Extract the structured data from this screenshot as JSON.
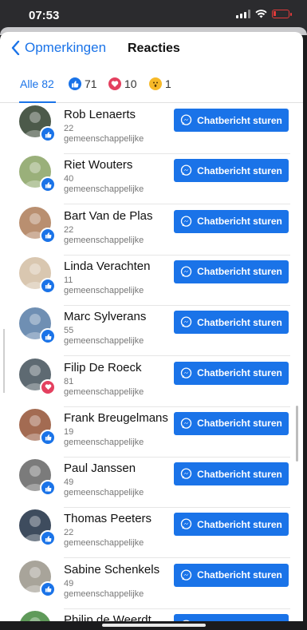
{
  "status": {
    "time": "07:53"
  },
  "nav": {
    "back_label": "Opmerkingen",
    "title": "Reacties"
  },
  "tabs": [
    {
      "label": "Alle 82"
    },
    {
      "label": "71",
      "icon": "like-icon",
      "color": "#1a73e8"
    },
    {
      "label": "10",
      "icon": "heart-icon",
      "color": "#e4405f"
    },
    {
      "label": "1",
      "icon": "wow-icon",
      "color": "#f7b928"
    }
  ],
  "chat_label": "Chatbericht sturen",
  "people": [
    {
      "name": "Rob Lenaerts",
      "count": "22",
      "sub": "gemeenschappelijke",
      "reaction": "like",
      "avatar_color": "#4c5a4a"
    },
    {
      "name": "Riet Wouters",
      "count": "40",
      "sub": "gemeenschappelijke",
      "reaction": "like",
      "avatar_color": "#9ab07a"
    },
    {
      "name": "Bart Van de Plas",
      "count": "22",
      "sub": "gemeenschappelijke",
      "reaction": "like",
      "avatar_color": "#b98f70"
    },
    {
      "name": "Linda Verachten",
      "count": "11",
      "sub": "gemeenschappelijke",
      "reaction": "like",
      "avatar_color": "#d9c7b0"
    },
    {
      "name": "Marc Sylverans",
      "count": "55",
      "sub": "gemeenschappelijke",
      "reaction": "like",
      "avatar_color": "#6f8fb3"
    },
    {
      "name": "Filip De Roeck",
      "count": "81",
      "sub": "gemeenschappelijke",
      "reaction": "heart",
      "avatar_color": "#5e6a72"
    },
    {
      "name": "Frank Breugelmans",
      "count": "19",
      "sub": "gemeenschappelijke",
      "reaction": "like",
      "avatar_color": "#a36b52"
    },
    {
      "name": "Paul Janssen",
      "count": "49",
      "sub": "gemeenschappelijke",
      "reaction": "like",
      "avatar_color": "#7b7b7b"
    },
    {
      "name": "Thomas Peeters",
      "count": "22",
      "sub": "gemeenschappelijke",
      "reaction": "like",
      "avatar_color": "#3e4c5e"
    },
    {
      "name": "Sabine Schenkels",
      "count": "49",
      "sub": "gemeenschappelijke",
      "reaction": "like",
      "avatar_color": "#a8a49a"
    },
    {
      "name": "Philip de Weerdt",
      "count": "",
      "sub": "",
      "reaction": "like",
      "avatar_color": "#5f9a5a"
    }
  ]
}
